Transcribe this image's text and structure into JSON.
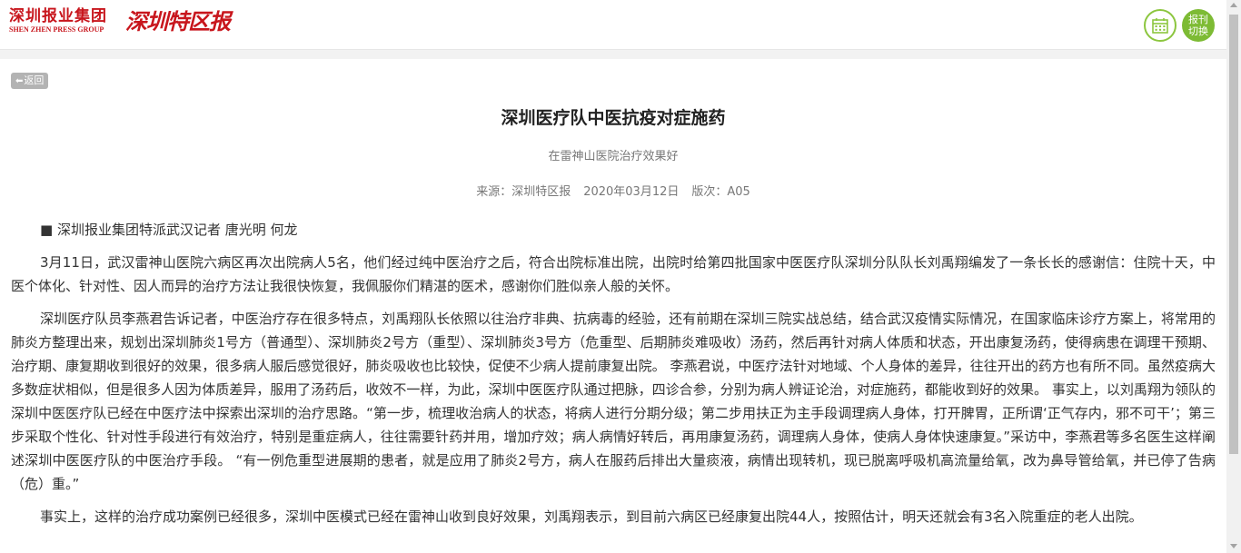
{
  "header": {
    "group_name_cn": "深圳报业集团",
    "group_name_en": "SHEN ZHEN PRESS GROUP",
    "paper_name": "深圳特区报",
    "switch_label_line1": "报刊",
    "switch_label_line2": "切换",
    "calendar_icon": "calendar-icon",
    "accent_color": "#7dbb34",
    "brand_color": "#c8161d"
  },
  "nav": {
    "back_label": "返回"
  },
  "article": {
    "title": "深圳医疗队中医抗疫对症施药",
    "subtitle": "在雷神山医院治疗效果好",
    "source": "来源：深圳特区报",
    "date": "2020年03月12日",
    "edition": "版次：A05",
    "byline": "■ 深圳报业集团特派武汉记者 唐光明 何龙",
    "paragraphs": [
      "3月11日，武汉雷神山医院六病区再次出院病人5名，他们经过纯中医治疗之后，符合出院标准出院，出院时给第四批国家中医医疗队深圳分队队长刘禹翔编发了一条长长的感谢信：住院十天，中医个体化、针对性、因人而异的治疗方法让我很快恢复，我佩服你们精湛的医术，感谢你们胜似亲人般的关怀。",
      "深圳医疗队员李燕君告诉记者，中医治疗存在很多特点，刘禹翔队长依照以往治疗非典、抗病毒的经验，还有前期在深圳三院实战总结，结合武汉疫情实际情况，在国家临床诊疗方案上，将常用的肺炎方整理出来，规划出深圳肺炎1号方（普通型）、深圳肺炎2号方（重型）、深圳肺炎3号方（危重型、后期肺炎难吸收）汤药，然后再针对病人体质和状态，开出康复汤药，使得病患在调理干预期、治疗期、康复期收到很好的效果，很多病人服后感觉很好，肺炎吸收也比较快，促使不少病人提前康复出院。 李燕君说，中医疗法针对地域、个人身体的差异，往往开出的药方也有所不同。虽然疫病大多数症状相似，但是很多人因为体质差异，服用了汤药后，收效不一样，为此，深圳中医医疗队通过把脉，四诊合参，分别为病人辨证论治，对症施药，都能收到好的效果。 事实上，以刘禹翔为领队的深圳中医医疗队已经在中医疗法中探索出深圳的治疗思路。“第一步，梳理收治病人的状态，将病人进行分期分级；第二步用扶正为主手段调理病人身体，打开脾胃，正所谓‘正气存内，邪不可干’；第三步采取个性化、针对性手段进行有效治疗，特别是重症病人，往往需要针药并用，增加疗效；病人病情好转后，再用康复汤药，调理病人身体，使病人身体快速康复。”采访中，李燕君等多名医生这样阐述深圳中医医疗队的中医治疗手段。 “有一例危重型进展期的患者，就是应用了肺炎2号方，病人在服药后排出大量痰液，病情出现转机，现已脱离呼吸机高流量给氧，改为鼻导管给氧，并已停了告病（危）重。”",
      "事实上，这样的治疗成功案例已经很多，深圳中医模式已经在雷神山收到良好效果，刘禹翔表示，到目前六病区已经康复出院44人，按照估计，明天还就会有3名入院重症的老人出院。"
    ]
  }
}
